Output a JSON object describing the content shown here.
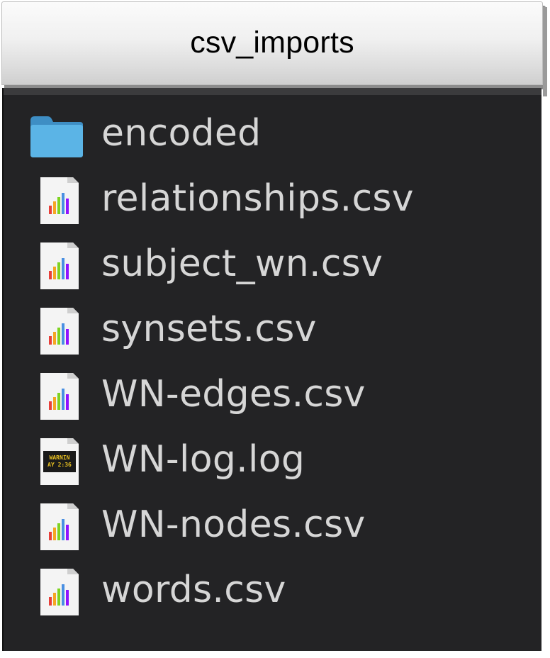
{
  "window": {
    "title": "csv_imports"
  },
  "files": [
    {
      "name": "encoded",
      "icon": "folder-icon"
    },
    {
      "name": "relationships.csv",
      "icon": "csv-file-icon"
    },
    {
      "name": "subject_wn.csv",
      "icon": "csv-file-icon"
    },
    {
      "name": "synsets.csv",
      "icon": "csv-file-icon"
    },
    {
      "name": "WN-edges.csv",
      "icon": "csv-file-icon"
    },
    {
      "name": "WN-log.log",
      "icon": "log-file-icon"
    },
    {
      "name": "WN-nodes.csv",
      "icon": "csv-file-icon"
    },
    {
      "name": "words.csv",
      "icon": "csv-file-icon"
    }
  ],
  "log_icon_text": "WARNIN\nAY 2:36",
  "colors": {
    "background": "#232325",
    "text": "#d6d6d6",
    "folder": "#4aa3d8"
  }
}
